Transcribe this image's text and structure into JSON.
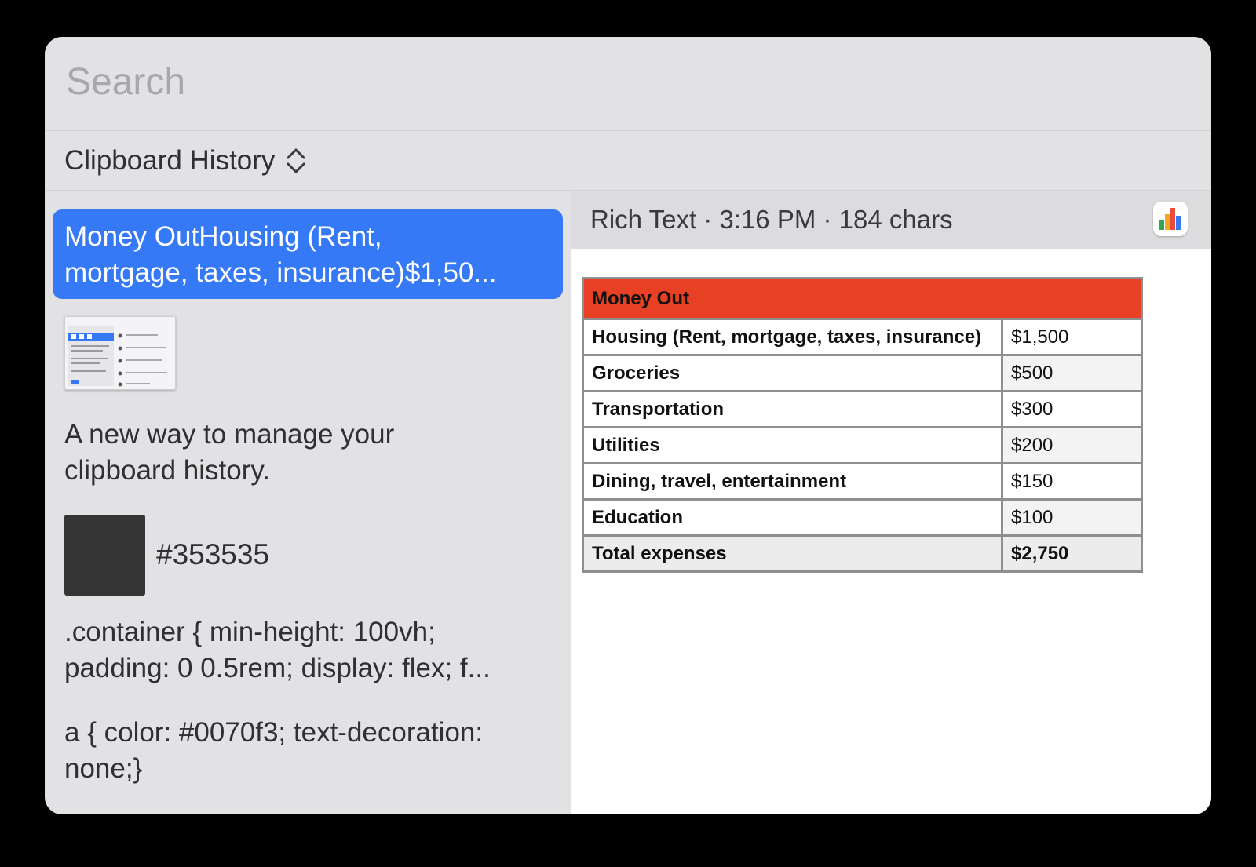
{
  "search": {
    "placeholder": "Search"
  },
  "category": {
    "label": "Clipboard History",
    "icon": "chevron-up-down-icon"
  },
  "history": {
    "selected_item": {
      "line1": "Money OutHousing (Rent,",
      "line2": "mortgage, taxes, insurance)$1,50..."
    },
    "text_item": {
      "line1": "A new way to manage your",
      "line2": "clipboard history."
    },
    "color_item": {
      "hex": "#353535",
      "swatch_color": "#353535"
    },
    "css_item_1": {
      "line1": ".container {  min-height: 100vh;",
      "line2": "padding: 0 0.5rem;  display: flex;  f..."
    },
    "css_item_2": {
      "line1": "a {  color: #0070f3;  text-decoration:",
      "line2": "none;}"
    }
  },
  "preview": {
    "meta": "Rich Text · 3:16 PM · 184 chars",
    "app_icon": "numbers-app-icon",
    "table": {
      "header": "Money Out",
      "header_color": "#e74025",
      "rows": [
        {
          "label": "Housing (Rent, mortgage, taxes, insurance)",
          "value": "$1,500"
        },
        {
          "label": "Groceries",
          "value": "$500"
        },
        {
          "label": "Transportation",
          "value": "$300"
        },
        {
          "label": "Utilities",
          "value": "$200"
        },
        {
          "label": "Dining, travel, entertainment",
          "value": "$150"
        },
        {
          "label": "Education",
          "value": "$100"
        }
      ],
      "total": {
        "label": "Total expenses",
        "value": "$2,750"
      }
    }
  },
  "colors": {
    "selection": "#3579f6",
    "window_bg": "#e2e2e4",
    "preview_bg": "#ffffff"
  }
}
